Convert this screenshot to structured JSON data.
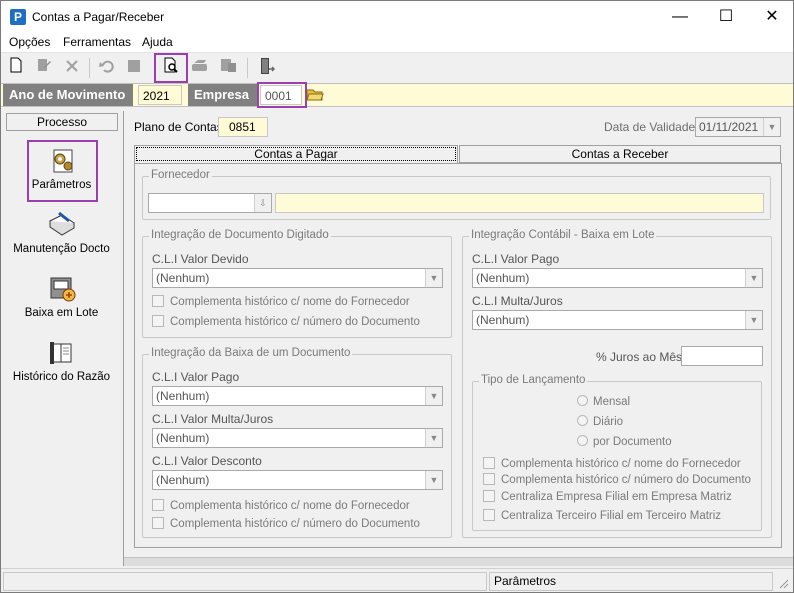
{
  "window": {
    "title": "Contas a Pagar/Receber",
    "app_icon_letter": "P",
    "minimize_glyph": "—",
    "maximize_glyph": "☐",
    "close_glyph": "✕"
  },
  "menu": {
    "items": [
      "Opções",
      "Ferramentas",
      "Ajuda"
    ]
  },
  "toolbar": {
    "icons": [
      "new-document-icon",
      "edit-icon",
      "delete-icon",
      "undo-icon",
      "stop-icon",
      "print-preview-icon",
      "print-icon",
      "export-icon",
      "exit-door-icon"
    ]
  },
  "yearbar": {
    "ano_label": "Ano de Movimento",
    "ano_value": "2021",
    "empresa_label": "Empresa",
    "empresa_value": "0001"
  },
  "sidebar": {
    "header": "Processo",
    "items": [
      {
        "label": "Parâmetros",
        "icon": "parameters-icon"
      },
      {
        "label": "Manutenção Docto",
        "icon": "document-maintenance-icon"
      },
      {
        "label": "Baixa em Lote",
        "icon": "batch-writeoff-icon"
      },
      {
        "label": "Histórico do Razão",
        "icon": "ledger-history-icon"
      }
    ]
  },
  "form": {
    "plano_label": "Plano de Contas",
    "plano_value": "0851",
    "validade_label": "Data de Validade",
    "validade_value": "01/11/2021",
    "tabs": [
      "Contas a Pagar",
      "Contas a Receber"
    ],
    "fornecedor_group": "Fornecedor",
    "integ_doc_group": "Integração de Documento Digitado",
    "integ_doc_cli_label": "C.L.I Valor Devido",
    "integ_doc_cli_value": "(Nenhum)",
    "integ_doc_chk1": "Complementa histórico c/ nome do Fornecedor",
    "integ_doc_chk2": "Complementa histórico c/ número do Documento",
    "integ_baixa_group": "Integração da Baixa de um Documento",
    "baixa_pago_label": "C.L.I Valor Pago",
    "baixa_pago_value": "(Nenhum)",
    "baixa_multa_label": "C.L.I Valor Multa/Juros",
    "baixa_multa_value": "(Nenhum)",
    "baixa_desc_label": "C.L.I Valor Desconto",
    "baixa_desc_value": "(Nenhum)",
    "baixa_chk1": "Complementa histórico c/ nome do Fornecedor",
    "baixa_chk2": "Complementa histórico c/ número do Documento",
    "lote_group": "Integração Contábil - Baixa em Lote",
    "lote_pago_label": "C.L.I Valor Pago",
    "lote_pago_value": "(Nenhum)",
    "lote_multa_label": "C.L.I Multa/Juros",
    "lote_multa_value": "(Nenhum)",
    "juros_label": "% Juros ao Mês",
    "tipo_group": "Tipo de Lançamento",
    "radio_mensal": "Mensal",
    "radio_diario": "Diário",
    "radio_por_doc": "por Documento",
    "tipo_chk1": "Complementa histórico c/ nome do Fornecedor",
    "tipo_chk2": "Complementa histórico c/ número do Documento",
    "tipo_chk3": "Centraliza Empresa Filial em Empresa Matriz",
    "tipo_chk4": "Centraliza Terceiro Filial em Terceiro Matriz"
  },
  "status": {
    "text": "Parâmetros"
  },
  "colors": {
    "highlight": "#9b3fb0",
    "yellow_field": "#fffbd6",
    "label_gray": "#808080"
  }
}
